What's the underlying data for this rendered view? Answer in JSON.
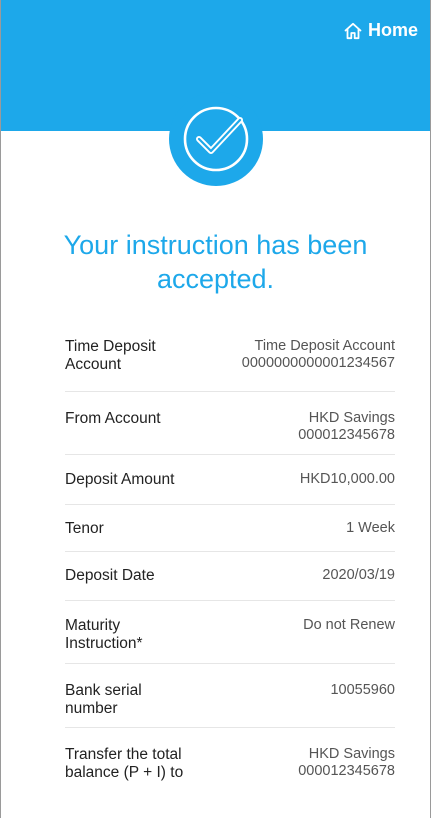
{
  "header": {
    "home_label": "Home",
    "background_color": "#1da8ea",
    "home_icon": "home-icon"
  },
  "status": {
    "icon": "checkmark-circle-icon",
    "message": "Your instruction has been accepted."
  },
  "details": [
    {
      "label": "Time Deposit Account",
      "value_lines": [
        "Time Deposit Account",
        "0000000000001234567"
      ]
    },
    {
      "label": "From Account",
      "value_lines": [
        "HKD Savings",
        "000012345678"
      ]
    },
    {
      "label": "Deposit Amount",
      "value_lines": [
        "HKD10,000.00"
      ]
    },
    {
      "label": "Tenor",
      "value_lines": [
        "1 Week"
      ]
    },
    {
      "label": "Deposit Date",
      "value_lines": [
        "2020/03/19"
      ]
    },
    {
      "label": "Maturity Instruction*",
      "value_lines": [
        "Do not Renew"
      ]
    },
    {
      "label": "Bank serial number",
      "value_lines": [
        "10055960"
      ]
    },
    {
      "label": "Transfer the total balance (P + I) to",
      "value_lines": [
        "HKD Savings",
        "000012345678"
      ]
    }
  ]
}
